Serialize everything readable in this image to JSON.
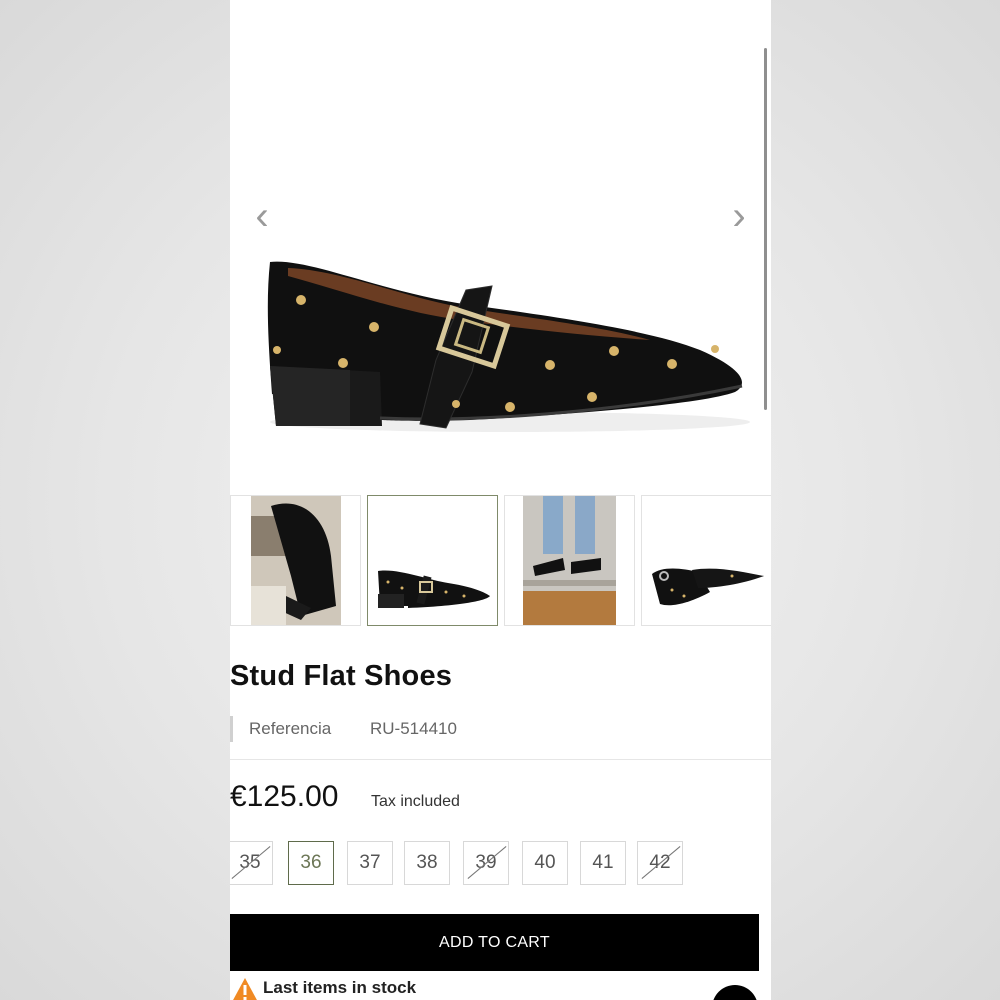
{
  "product": {
    "title": "Stud Flat Shoes",
    "reference_label": "Referencia",
    "reference_value": "RU-514410",
    "price": "€125.00",
    "tax_note": "Tax included"
  },
  "gallery": {
    "prev_arrow": "‹",
    "next_arrow": "›",
    "thumbnails": [
      {
        "name": "lifestyle-sofa"
      },
      {
        "name": "side-view",
        "selected": true
      },
      {
        "name": "street-wear"
      },
      {
        "name": "front-view"
      }
    ]
  },
  "sizes": [
    {
      "label": "35",
      "available": false
    },
    {
      "label": "36",
      "available": true,
      "selected": true
    },
    {
      "label": "37",
      "available": true
    },
    {
      "label": "38",
      "available": true
    },
    {
      "label": "39",
      "available": false
    },
    {
      "label": "40",
      "available": true
    },
    {
      "label": "41",
      "available": true
    },
    {
      "label": "42",
      "available": false
    }
  ],
  "actions": {
    "add_to_cart": "ADD TO CART"
  },
  "stock": {
    "message": "Last items in stock",
    "icon": "warning-icon"
  },
  "colors": {
    "accent": "#6c7656",
    "cart_bg": "#000000",
    "warning": "#f08a24"
  }
}
